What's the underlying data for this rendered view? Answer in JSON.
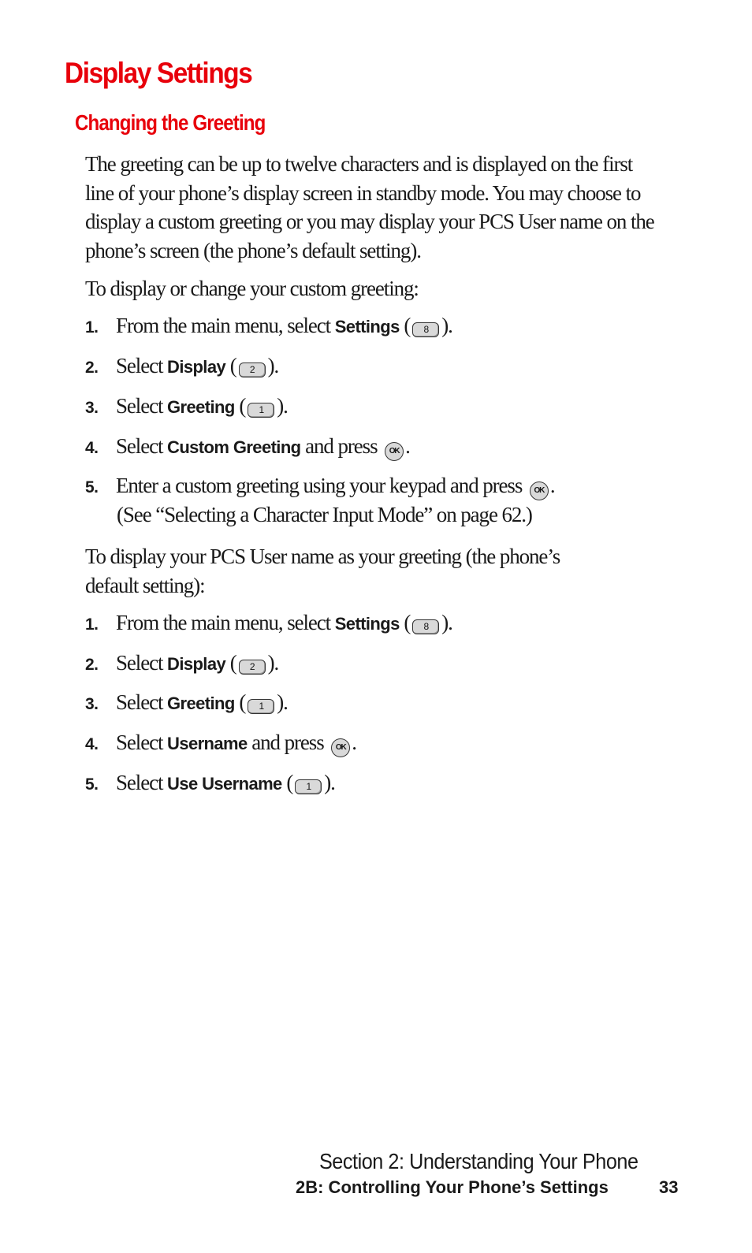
{
  "page_title": "Display Settings",
  "section_title": "Changing the Greeting",
  "intro_paragraph_lines": [
    "The greeting can be up to twelve characters and is displayed on the first",
    "line of your phone’s display screen in standby mode. You may choose to",
    "display a custom greeting or you may display your PCS User name on the",
    "phone’s screen (the phone’s default setting)."
  ],
  "custom_greeting": {
    "lead_in": "To display or change your custom greeting:",
    "steps": [
      {
        "num": "1.",
        "pre": "From the main menu, select ",
        "term": "Settings",
        "post_open": " (",
        "key": "8",
        "post_close": ")."
      },
      {
        "num": "2.",
        "pre": "Select ",
        "term": "Display",
        "post_open": " (",
        "key": "2",
        "post_close": ")."
      },
      {
        "num": "3.",
        "pre": "Select ",
        "term": "Greeting",
        "post_open": " (",
        "key": "1",
        "post_close": ")."
      },
      {
        "num": "4.",
        "pre": "Select ",
        "term": "Custom Greeting",
        "post": " and press ",
        "ok": "OK",
        "end": "."
      },
      {
        "num": "5.",
        "pre": "Enter a custom greeting using your keypad and press ",
        "ok": "OK",
        "end": ".",
        "continuation": "(See “Selecting a Character Input Mode” on page 62.)"
      }
    ]
  },
  "username_greeting": {
    "lead_in_lines": [
      "To display your PCS User name as your greeting (the phone’s",
      "default setting):"
    ],
    "steps": [
      {
        "num": "1.",
        "pre": "From the main menu, select ",
        "term": "Settings",
        "post_open": " (",
        "key": "8",
        "post_close": ")."
      },
      {
        "num": "2.",
        "pre": "Select ",
        "term": "Display",
        "post_open": " (",
        "key": "2",
        "post_close": ")."
      },
      {
        "num": "3.",
        "pre": "Select ",
        "term": "Greeting",
        "post_open": " (",
        "key": "1",
        "post_close": ")."
      },
      {
        "num": "4.",
        "pre": "Select ",
        "term": "Username",
        "post": " and press ",
        "ok": "OK",
        "end": "."
      },
      {
        "num": "5.",
        "pre": "Select ",
        "term": "Use Username",
        "post_open": " (",
        "key": "1",
        "post_close": ")."
      }
    ]
  },
  "footer": {
    "section": "Section 2: Understanding Your Phone",
    "chapter": "2B: Controlling Your Phone’s Settings",
    "page_number": "33"
  },
  "colors": {
    "heading_red": "#e8000b",
    "body_text": "#1a1a1a",
    "key_fill": "#d9d9d9"
  }
}
